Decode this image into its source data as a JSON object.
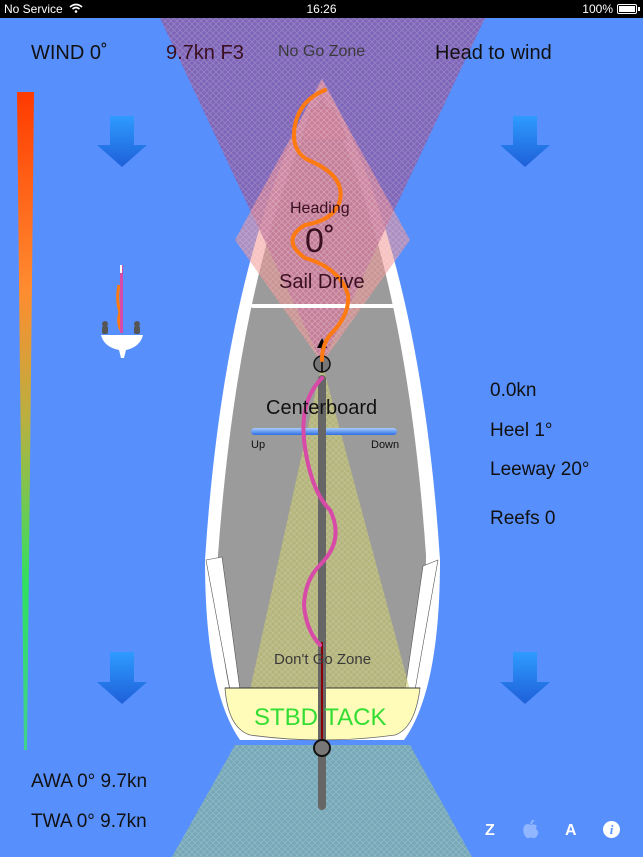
{
  "status_bar": {
    "carrier": "No Service",
    "time": "16:26",
    "battery": "100%"
  },
  "header": {
    "wind_direction": "WIND 0˚",
    "wind_speed": "9.7kn F3",
    "no_go_zone": "No Go Zone",
    "point_of_sail": "Head to wind"
  },
  "boat": {
    "heading_label": "Heading",
    "heading_value": "0˚",
    "sail_drive_label": "Sail Drive",
    "centerboard_label": "Centerboard",
    "centerboard_up": "Up",
    "centerboard_down": "Down",
    "dont_go_zone": "Don't Go Zone",
    "tack": "STBD TACK"
  },
  "stats": {
    "speed": "0.0kn",
    "heel": "Heel 1°",
    "leeway": "Leeway 20°",
    "reefs": "Reefs 0"
  },
  "wind_readouts": {
    "awa": "AWA 0° 9.7kn",
    "twa": "TWA 0° 9.7kn"
  },
  "footer": {
    "z_label": "Z",
    "a_label": "A",
    "info_label": "i"
  },
  "colors": {
    "background": "#578ffd",
    "tack_text": "#33dd33",
    "no_go_zone": "#8a5aa6",
    "hull": "#9a9a9a",
    "sail_trace": "#ff7a10",
    "board_trace": "#d84aa8"
  }
}
